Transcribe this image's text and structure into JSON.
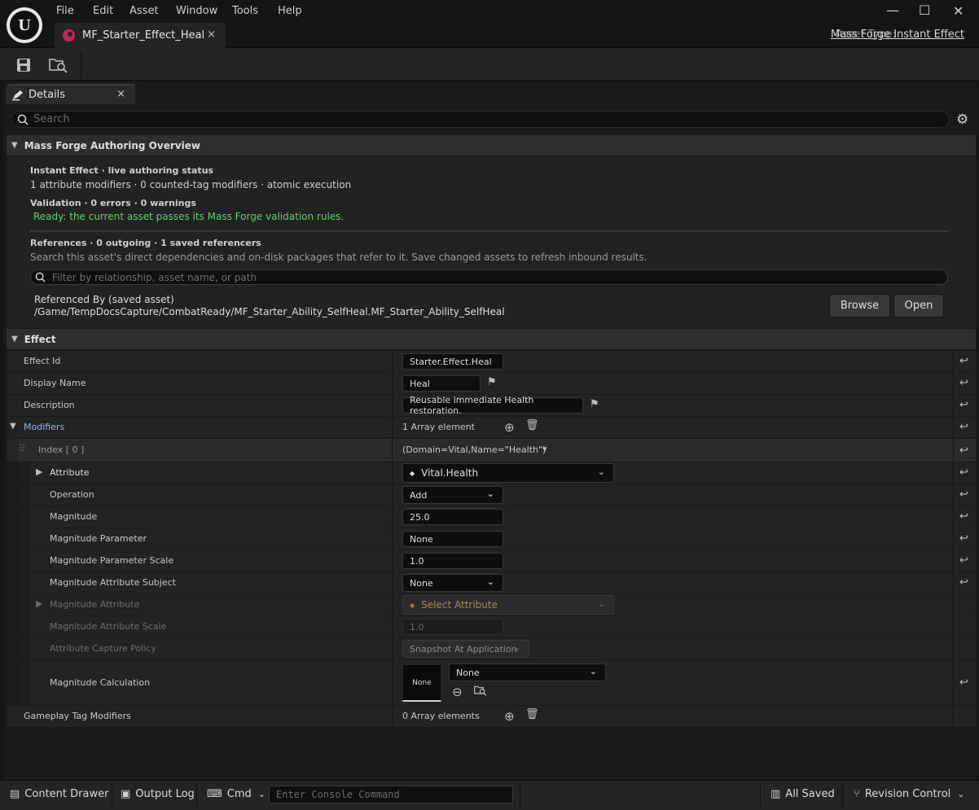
{
  "menu": [
    "File",
    "Edit",
    "Asset",
    "Window",
    "Tools",
    "Help"
  ],
  "logo_text": "U",
  "tab": {
    "name": "MF_Starter_Effect_Heal",
    "close": "×"
  },
  "window_controls": {
    "minimize": "—",
    "maximize": "☐",
    "close": "✕"
  },
  "asset_type": {
    "label": "Asset Type:",
    "value": "Mass Forge Instant Effect"
  },
  "details_tab": {
    "label": "Details",
    "close": "×"
  },
  "search": {
    "placeholder": "Search"
  },
  "overview": {
    "header": "Mass Forge Authoring Overview",
    "status_title": "Instant Effect · live authoring status",
    "status_text": "1 attribute modifiers · 0 counted-tag modifiers · atomic execution",
    "validation_title": "Validation · 0 errors · 0 warnings",
    "validation_text": "Ready: the current asset passes its Mass Forge validation rules.",
    "validation_color": "#5fd06a",
    "references_title": "References · 0 outgoing · 1 saved referencers",
    "references_text": "Search this asset's direct dependencies and on-disk packages that refer to it. Save changed assets to refresh inbound results.",
    "filter_placeholder": "Filter by relationship, asset name, or path",
    "ref_by_label": "Referenced By (saved asset)",
    "ref_by_path": "/Game/TempDocsCapture/CombatReady/MF_Starter_Ability_SelfHeal.MF_Starter_Ability_SelfHeal",
    "browse": "Browse",
    "open": "Open"
  },
  "effect": {
    "header": "Effect",
    "effect_id_label": "Effect Id",
    "effect_id_value": "Starter.Effect.Heal",
    "display_name_label": "Display Name",
    "display_name_value": "Heal",
    "description_label": "Description",
    "description_value": "Reusable immediate Health restoration.",
    "modifiers_label": "Modifiers",
    "modifiers_value": "1 Array element",
    "index_label": "Index [ 0 ]",
    "index_value": "(Domain=Vital,Name=\"Health\")",
    "attribute_label": "Attribute",
    "attribute_value": "Vital.Health",
    "operation_label": "Operation",
    "operation_value": "Add",
    "magnitude_label": "Magnitude",
    "magnitude_value": "25.0",
    "mag_param_label": "Magnitude Parameter",
    "mag_param_value": "None",
    "mag_param_scale_label": "Magnitude Parameter Scale",
    "mag_param_scale_value": "1.0",
    "mag_attr_subject_label": "Magnitude Attribute Subject",
    "mag_attr_subject_value": "None",
    "mag_attr_label": "Magnitude Attribute",
    "mag_attr_value": "Select Attribute",
    "mag_attr_scale_label": "Magnitude Attribute Scale",
    "mag_attr_scale_value": "1.0",
    "capture_policy_label": "Attribute Capture Policy",
    "capture_policy_value": "Snapshot At Application",
    "mag_calc_label": "Magnitude Calculation",
    "mag_calc_thumb": "None",
    "mag_calc_value": "None",
    "gameplay_tag_label": "Gameplay Tag Modifiers",
    "gameplay_tag_value": "0 Array elements"
  },
  "status_bar": {
    "content_drawer": "Content Drawer",
    "output_log": "Output Log",
    "cmd": "Cmd",
    "console_placeholder": "Enter Console Command",
    "all_saved": "All Saved",
    "revision_control": "Revision Control"
  }
}
